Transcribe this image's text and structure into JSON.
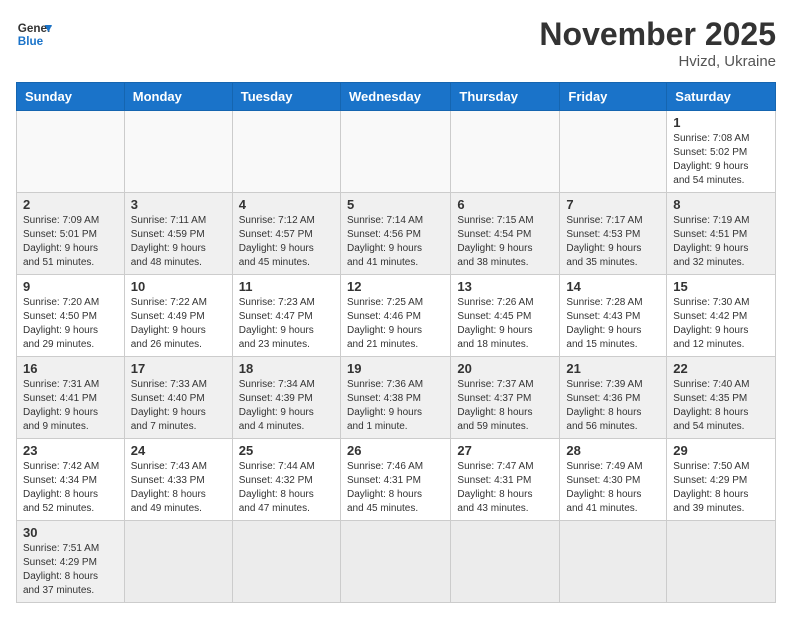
{
  "header": {
    "logo_general": "General",
    "logo_blue": "Blue",
    "month_title": "November 2025",
    "location": "Hvizd, Ukraine"
  },
  "weekdays": [
    "Sunday",
    "Monday",
    "Tuesday",
    "Wednesday",
    "Thursday",
    "Friday",
    "Saturday"
  ],
  "weeks": [
    [
      {
        "day": "",
        "info": ""
      },
      {
        "day": "",
        "info": ""
      },
      {
        "day": "",
        "info": ""
      },
      {
        "day": "",
        "info": ""
      },
      {
        "day": "",
        "info": ""
      },
      {
        "day": "",
        "info": ""
      },
      {
        "day": "1",
        "info": "Sunrise: 7:08 AM\nSunset: 5:02 PM\nDaylight: 9 hours\nand 54 minutes."
      }
    ],
    [
      {
        "day": "2",
        "info": "Sunrise: 7:09 AM\nSunset: 5:01 PM\nDaylight: 9 hours\nand 51 minutes."
      },
      {
        "day": "3",
        "info": "Sunrise: 7:11 AM\nSunset: 4:59 PM\nDaylight: 9 hours\nand 48 minutes."
      },
      {
        "day": "4",
        "info": "Sunrise: 7:12 AM\nSunset: 4:57 PM\nDaylight: 9 hours\nand 45 minutes."
      },
      {
        "day": "5",
        "info": "Sunrise: 7:14 AM\nSunset: 4:56 PM\nDaylight: 9 hours\nand 41 minutes."
      },
      {
        "day": "6",
        "info": "Sunrise: 7:15 AM\nSunset: 4:54 PM\nDaylight: 9 hours\nand 38 minutes."
      },
      {
        "day": "7",
        "info": "Sunrise: 7:17 AM\nSunset: 4:53 PM\nDaylight: 9 hours\nand 35 minutes."
      },
      {
        "day": "8",
        "info": "Sunrise: 7:19 AM\nSunset: 4:51 PM\nDaylight: 9 hours\nand 32 minutes."
      }
    ],
    [
      {
        "day": "9",
        "info": "Sunrise: 7:20 AM\nSunset: 4:50 PM\nDaylight: 9 hours\nand 29 minutes."
      },
      {
        "day": "10",
        "info": "Sunrise: 7:22 AM\nSunset: 4:49 PM\nDaylight: 9 hours\nand 26 minutes."
      },
      {
        "day": "11",
        "info": "Sunrise: 7:23 AM\nSunset: 4:47 PM\nDaylight: 9 hours\nand 23 minutes."
      },
      {
        "day": "12",
        "info": "Sunrise: 7:25 AM\nSunset: 4:46 PM\nDaylight: 9 hours\nand 21 minutes."
      },
      {
        "day": "13",
        "info": "Sunrise: 7:26 AM\nSunset: 4:45 PM\nDaylight: 9 hours\nand 18 minutes."
      },
      {
        "day": "14",
        "info": "Sunrise: 7:28 AM\nSunset: 4:43 PM\nDaylight: 9 hours\nand 15 minutes."
      },
      {
        "day": "15",
        "info": "Sunrise: 7:30 AM\nSunset: 4:42 PM\nDaylight: 9 hours\nand 12 minutes."
      }
    ],
    [
      {
        "day": "16",
        "info": "Sunrise: 7:31 AM\nSunset: 4:41 PM\nDaylight: 9 hours\nand 9 minutes."
      },
      {
        "day": "17",
        "info": "Sunrise: 7:33 AM\nSunset: 4:40 PM\nDaylight: 9 hours\nand 7 minutes."
      },
      {
        "day": "18",
        "info": "Sunrise: 7:34 AM\nSunset: 4:39 PM\nDaylight: 9 hours\nand 4 minutes."
      },
      {
        "day": "19",
        "info": "Sunrise: 7:36 AM\nSunset: 4:38 PM\nDaylight: 9 hours\nand 1 minute."
      },
      {
        "day": "20",
        "info": "Sunrise: 7:37 AM\nSunset: 4:37 PM\nDaylight: 8 hours\nand 59 minutes."
      },
      {
        "day": "21",
        "info": "Sunrise: 7:39 AM\nSunset: 4:36 PM\nDaylight: 8 hours\nand 56 minutes."
      },
      {
        "day": "22",
        "info": "Sunrise: 7:40 AM\nSunset: 4:35 PM\nDaylight: 8 hours\nand 54 minutes."
      }
    ],
    [
      {
        "day": "23",
        "info": "Sunrise: 7:42 AM\nSunset: 4:34 PM\nDaylight: 8 hours\nand 52 minutes."
      },
      {
        "day": "24",
        "info": "Sunrise: 7:43 AM\nSunset: 4:33 PM\nDaylight: 8 hours\nand 49 minutes."
      },
      {
        "day": "25",
        "info": "Sunrise: 7:44 AM\nSunset: 4:32 PM\nDaylight: 8 hours\nand 47 minutes."
      },
      {
        "day": "26",
        "info": "Sunrise: 7:46 AM\nSunset: 4:31 PM\nDaylight: 8 hours\nand 45 minutes."
      },
      {
        "day": "27",
        "info": "Sunrise: 7:47 AM\nSunset: 4:31 PM\nDaylight: 8 hours\nand 43 minutes."
      },
      {
        "day": "28",
        "info": "Sunrise: 7:49 AM\nSunset: 4:30 PM\nDaylight: 8 hours\nand 41 minutes."
      },
      {
        "day": "29",
        "info": "Sunrise: 7:50 AM\nSunset: 4:29 PM\nDaylight: 8 hours\nand 39 minutes."
      }
    ],
    [
      {
        "day": "30",
        "info": "Sunrise: 7:51 AM\nSunset: 4:29 PM\nDaylight: 8 hours\nand 37 minutes."
      },
      {
        "day": "",
        "info": ""
      },
      {
        "day": "",
        "info": ""
      },
      {
        "day": "",
        "info": ""
      },
      {
        "day": "",
        "info": ""
      },
      {
        "day": "",
        "info": ""
      },
      {
        "day": "",
        "info": ""
      }
    ]
  ]
}
